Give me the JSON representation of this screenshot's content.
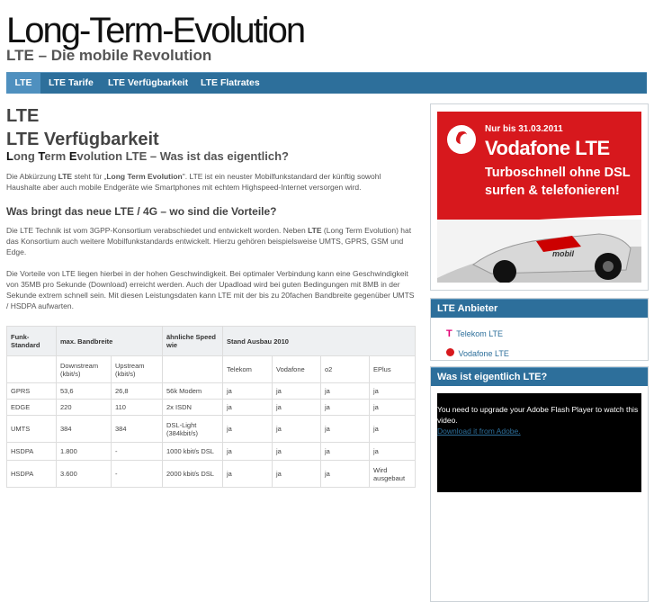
{
  "header": {
    "site_title": "Long-Term-Evolution",
    "site_subtitle": "LTE – Die mobile Revolution"
  },
  "nav": {
    "items": [
      {
        "label": "LTE",
        "active": true
      },
      {
        "label": "LTE Tarife",
        "active": false
      },
      {
        "label": "LTE Verfügbarkeit",
        "active": false
      },
      {
        "label": "LTE Flatrates",
        "active": false
      }
    ]
  },
  "content": {
    "heading1": "LTE",
    "heading2": "LTE Verfügbarkeit",
    "heading3_parts": [
      "L",
      "ong ",
      "T",
      "erm ",
      "E",
      "volution LTE – Was ist das eigentlich?"
    ],
    "intro": {
      "p1": "Die Abkürzung ",
      "p1_bold": "LTE",
      "p2": " steht für „",
      "p2_bold": "Long Term Evolution",
      "p3": "\". LTE ist ein neuster Mobilfunkstandard der künftig sowohl Haushalte aber auch mobile Endgeräte wie Smartphones mit echtem Highspeed-Internet versorgen wird."
    },
    "heading4": "Was bringt das neue LTE / 4G – wo sind die Vorteile?",
    "para2_a": "Die LTE Technik ist vom 3GPP-Konsortium verabschiedet und entwickelt worden. Neben ",
    "para2_bold": "LTE",
    "para2_b": " (Long Term Evolution) hat das Konsortium auch weitere Mobilfunkstandards entwickelt. Hierzu gehören beispielsweise UMTS, GPRS, GSM und Edge.",
    "para3": "Die Vorteile von LTE liegen hierbei in der hohen Geschwindigkeit. Bei optimaler Verbindung kann eine Geschwindigkeit von 35MB pro Sekunde (Download) erreicht werden. Auch der Upadload wird bei guten Bedingungen mit 8MB in der Sekunde extrem schnell sein. Mit diesen Leistungsdaten kann LTE mit der bis zu 20fachen Bandbreite gegenüber UMTS / HSDPA aufwarten."
  },
  "table": {
    "header": [
      "Funk-Standard",
      "max. Bandbreite",
      "ähnliche Speed wie",
      "Stand Ausbau 2010"
    ],
    "subheader": [
      "",
      "Downstream (kbit/s)",
      "Upstream (kbit/s)",
      "",
      "Telekom",
      "Vodafone",
      "o2",
      "EPlus"
    ],
    "rows": [
      [
        "GPRS",
        "53,6",
        "26,8",
        "56k Modem",
        "ja",
        "ja",
        "ja",
        "ja"
      ],
      [
        "EDGE",
        "220",
        "110",
        "2x ISDN",
        "ja",
        "ja",
        "ja",
        "ja"
      ],
      [
        "UMTS",
        "384",
        "384",
        "DSL-Light (384kbit/s)",
        "ja",
        "ja",
        "ja",
        "ja"
      ],
      [
        "HSDPA",
        "1.800",
        "-",
        "1000 kbit/s DSL",
        "ja",
        "ja",
        "ja",
        "ja"
      ],
      [
        "HSDPA",
        "3.600",
        "-",
        "2000 kbit/s DSL",
        "ja",
        "ja",
        "ja",
        "Wird ausgebaut"
      ]
    ]
  },
  "sidebar": {
    "ad": {
      "badge": "Nur bis 31.03.2011",
      "brand": "Vodafone LTE",
      "line1": "Turboschnell ohne DSL",
      "line2": "surfen & telefonieren!",
      "car_brand": "mobil"
    },
    "anbieter": {
      "title": "LTE Anbieter",
      "items": [
        {
          "label": "Telekom LTE",
          "logo": "T"
        },
        {
          "label": "Vodafone LTE",
          "logo": ""
        }
      ]
    },
    "video": {
      "title": "Was ist eigentlich LTE?",
      "message": "You need to upgrade your Adobe Flash Player to watch this video.",
      "link": "Download it from Adobe."
    }
  },
  "colors": {
    "nav_bg": "#2d6f9b",
    "nav_active": "#4f90bf",
    "vodafone_red": "#d7181d",
    "telekom_magenta": "#e20074"
  }
}
